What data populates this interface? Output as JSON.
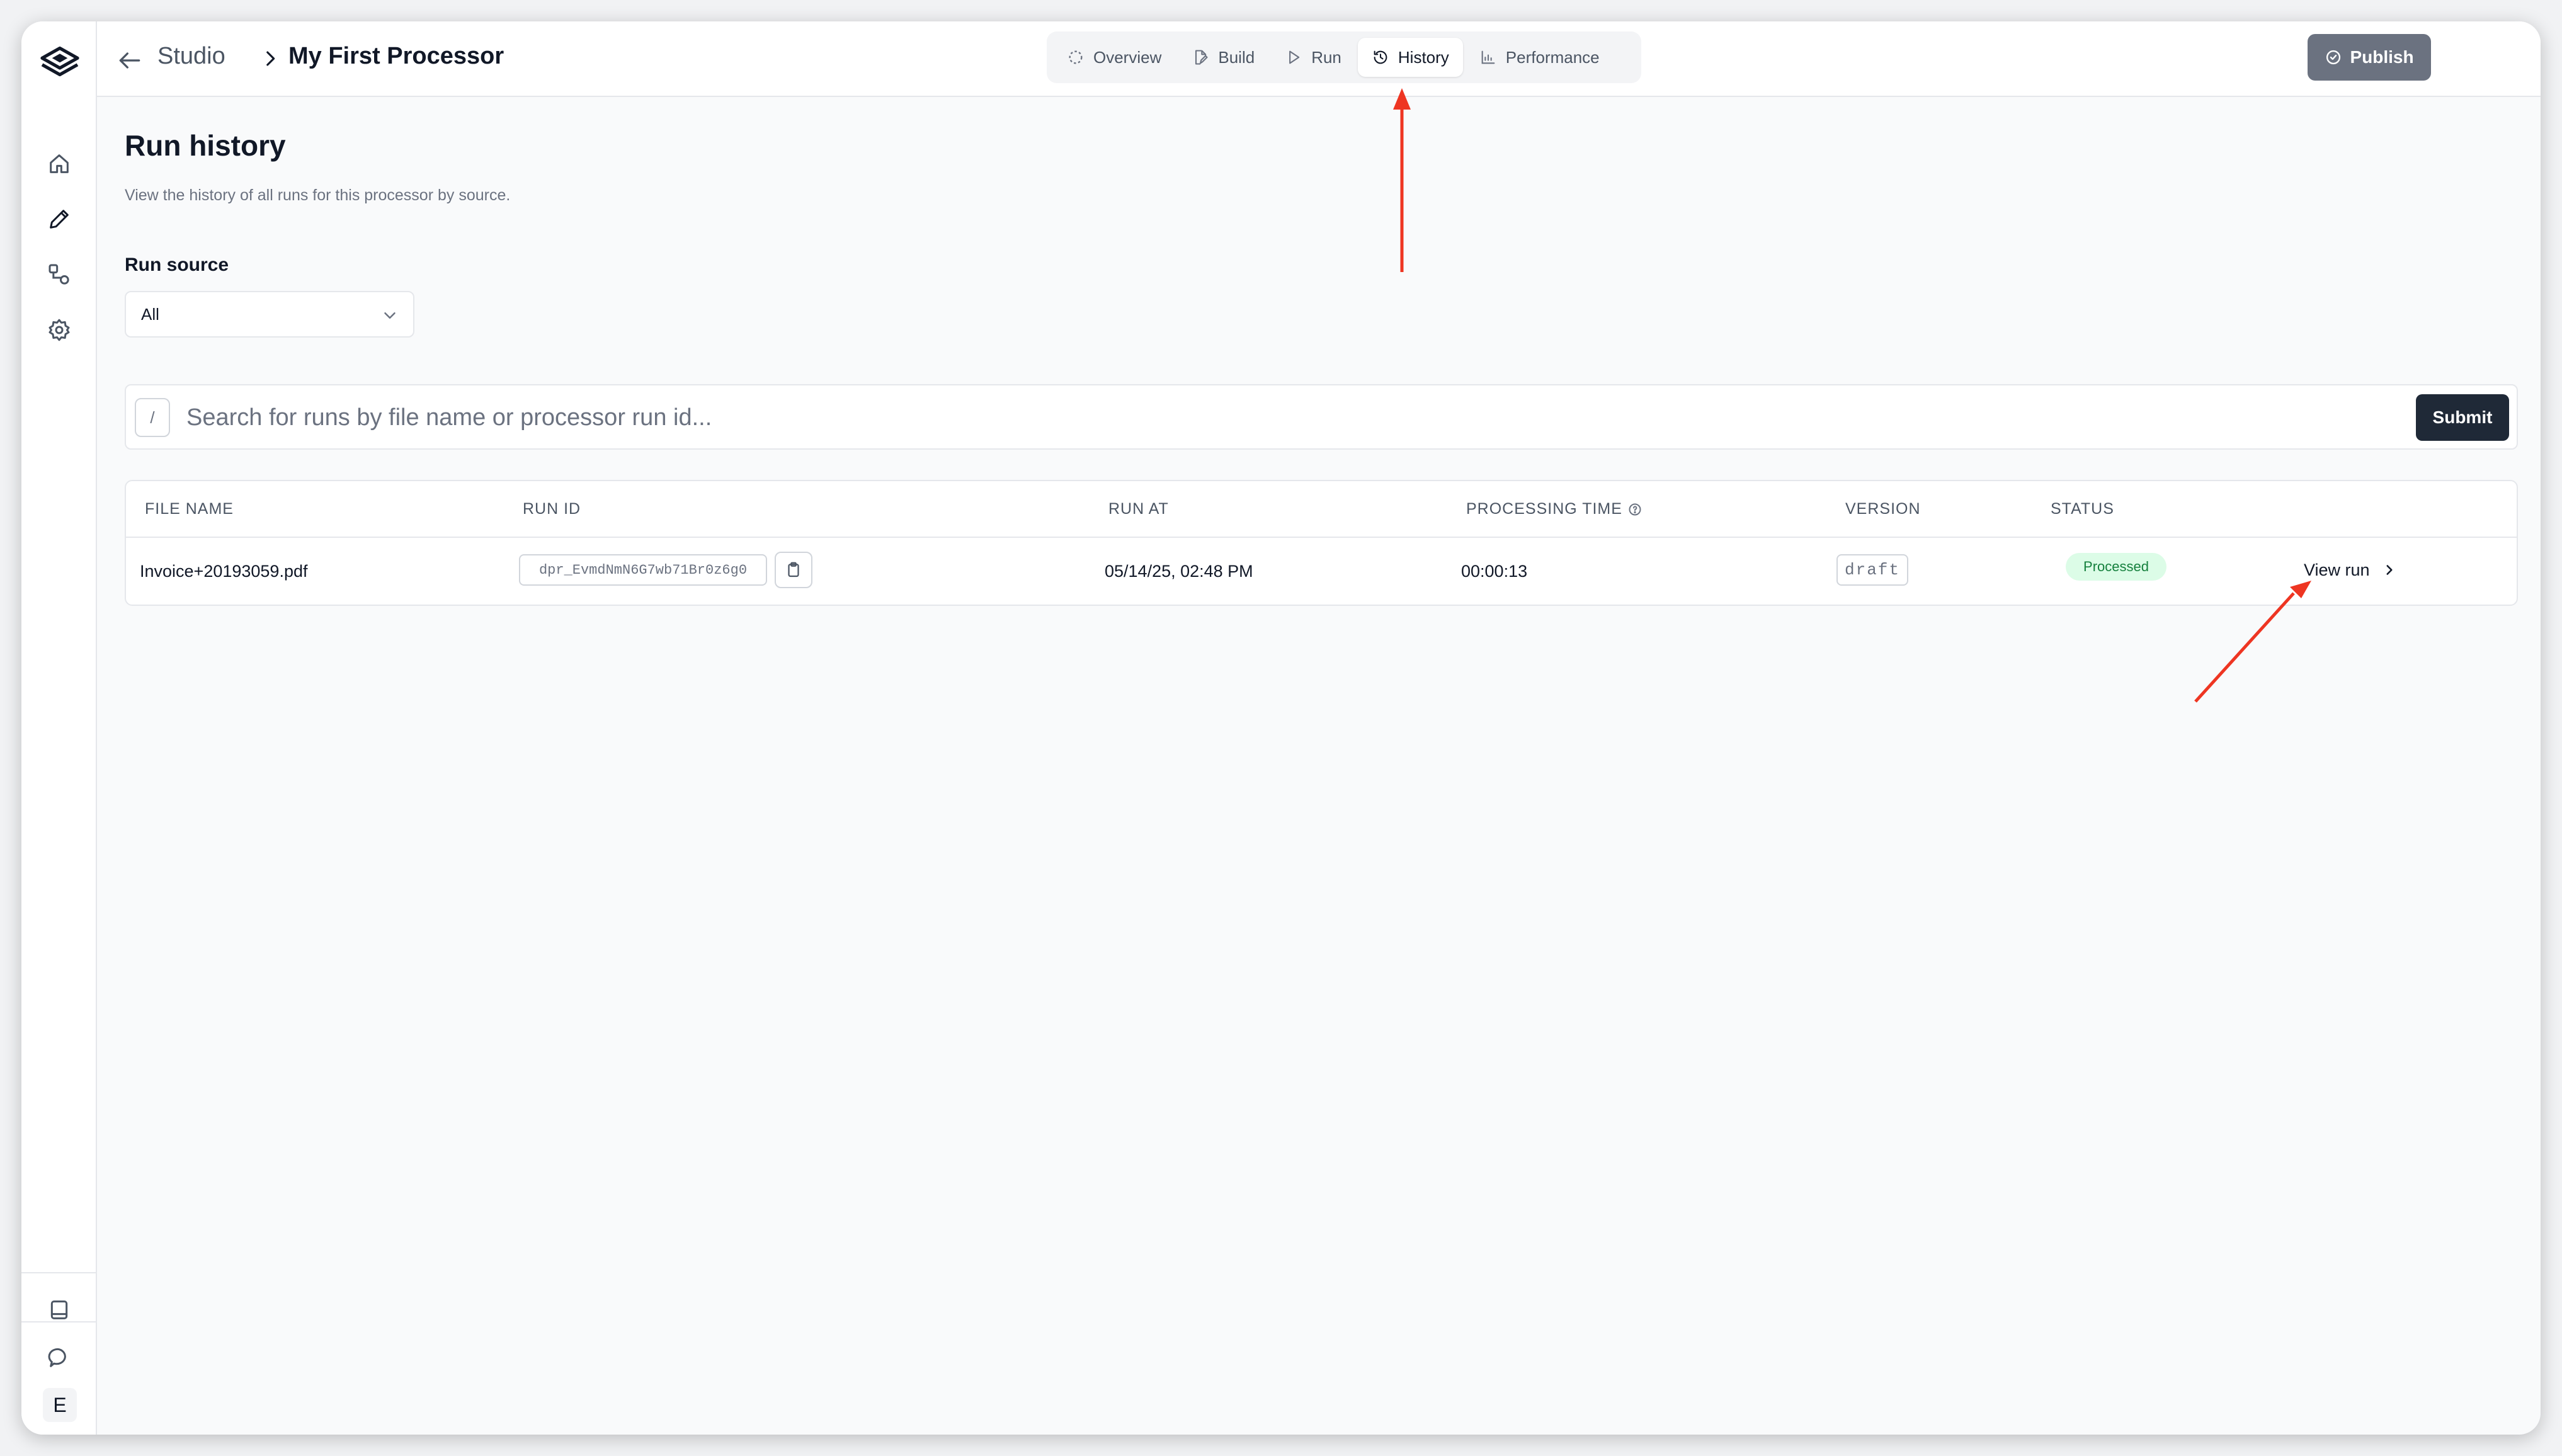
{
  "header": {
    "back_icon": "arrow-left-icon",
    "breadcrumb_root": "Studio",
    "breadcrumb_title": "My First Processor",
    "tabs": [
      {
        "label": "Overview",
        "icon": "dashed-circle-icon"
      },
      {
        "label": "Build",
        "icon": "file-pen-icon"
      },
      {
        "label": "Run",
        "icon": "play-icon"
      },
      {
        "label": "History",
        "icon": "history-icon",
        "active": true
      },
      {
        "label": "Performance",
        "icon": "chart-icon"
      }
    ],
    "publish_label": "Publish",
    "accent_color": "#6b7280"
  },
  "sidebar": {
    "icons": [
      "logo-icon",
      "home-icon",
      "pencil-icon",
      "workflow-icon",
      "gear-icon",
      "book-icon",
      "chat-icon"
    ],
    "avatar_initial": "E"
  },
  "main": {
    "title": "Run history",
    "subtitle": "View the history of all runs for this processor by source.",
    "run_source_label": "Run source",
    "run_source_value": "All",
    "search_kbd": "/",
    "search_placeholder": "Search for runs by file name or processor run id...",
    "submit_label": "Submit"
  },
  "table": {
    "columns": [
      "FILE NAME",
      "RUN ID",
      "RUN AT",
      "PROCESSING TIME",
      "VERSION",
      "STATUS"
    ],
    "rows": [
      {
        "file_name": "Invoice+20193059.pdf",
        "run_id": "dpr_EvmdNmN6G7wb71Br0z6g0",
        "run_at": "05/14/25, 02:48 PM",
        "processing_time": "00:00:13",
        "version": "draft",
        "status": "Processed",
        "action": "View run"
      }
    ],
    "status_color": "#15803d"
  },
  "annotations": {
    "arrow_color": "#ee3522"
  }
}
